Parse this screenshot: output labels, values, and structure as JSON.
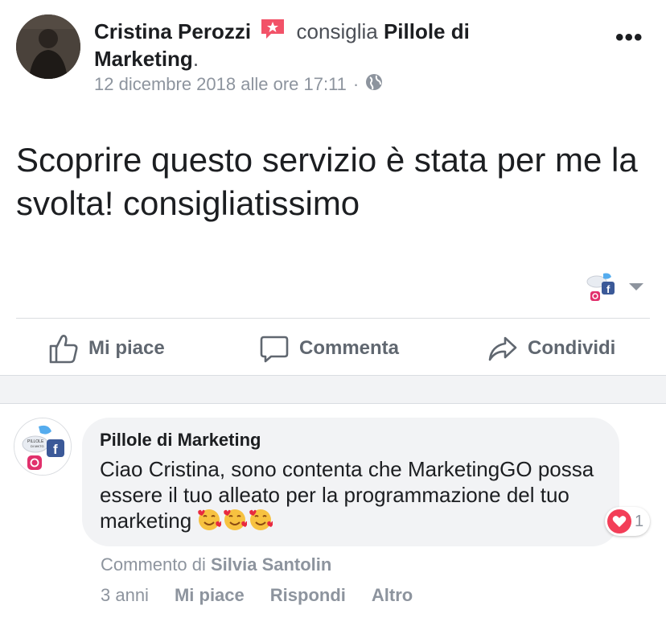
{
  "post": {
    "author_name": "Cristina Perozzi",
    "verb": "consiglia",
    "page_name": "Pillole di Marketing",
    "period": ".",
    "timestamp": "12 dicembre 2018 alle ore 17:11",
    "separator": "·",
    "privacy_icon": "globe-icon",
    "more_label": "•••",
    "text": "Scoprire questo servizio è stata per me la svolta! consigliatissimo"
  },
  "actions": {
    "like_label": "Mi piace",
    "comment_label": "Commenta",
    "share_label": "Condividi"
  },
  "comment": {
    "author": "Pillole di Marketing",
    "text": "Ciao Cristina, sono contenta che MarketingGO possa essere il tuo alleato per la programmazione del tuo marketing",
    "emojis": [
      "smiling-face-with-hearts",
      "smiling-face-with-hearts",
      "smiling-face-with-hearts"
    ],
    "reaction_count": "1",
    "byline_prefix": "Commento di",
    "byline_author": "Silvia Santolin",
    "age": "3 anni",
    "like_label": "Mi piace",
    "reply_label": "Rispondi",
    "more_label": "Altro"
  },
  "colors": {
    "text": "#1c1e21",
    "secondary": "#8d949e",
    "action": "#606770",
    "bubble": "#f2f3f5",
    "heart": "#f33e58",
    "badge": "#f25268"
  }
}
